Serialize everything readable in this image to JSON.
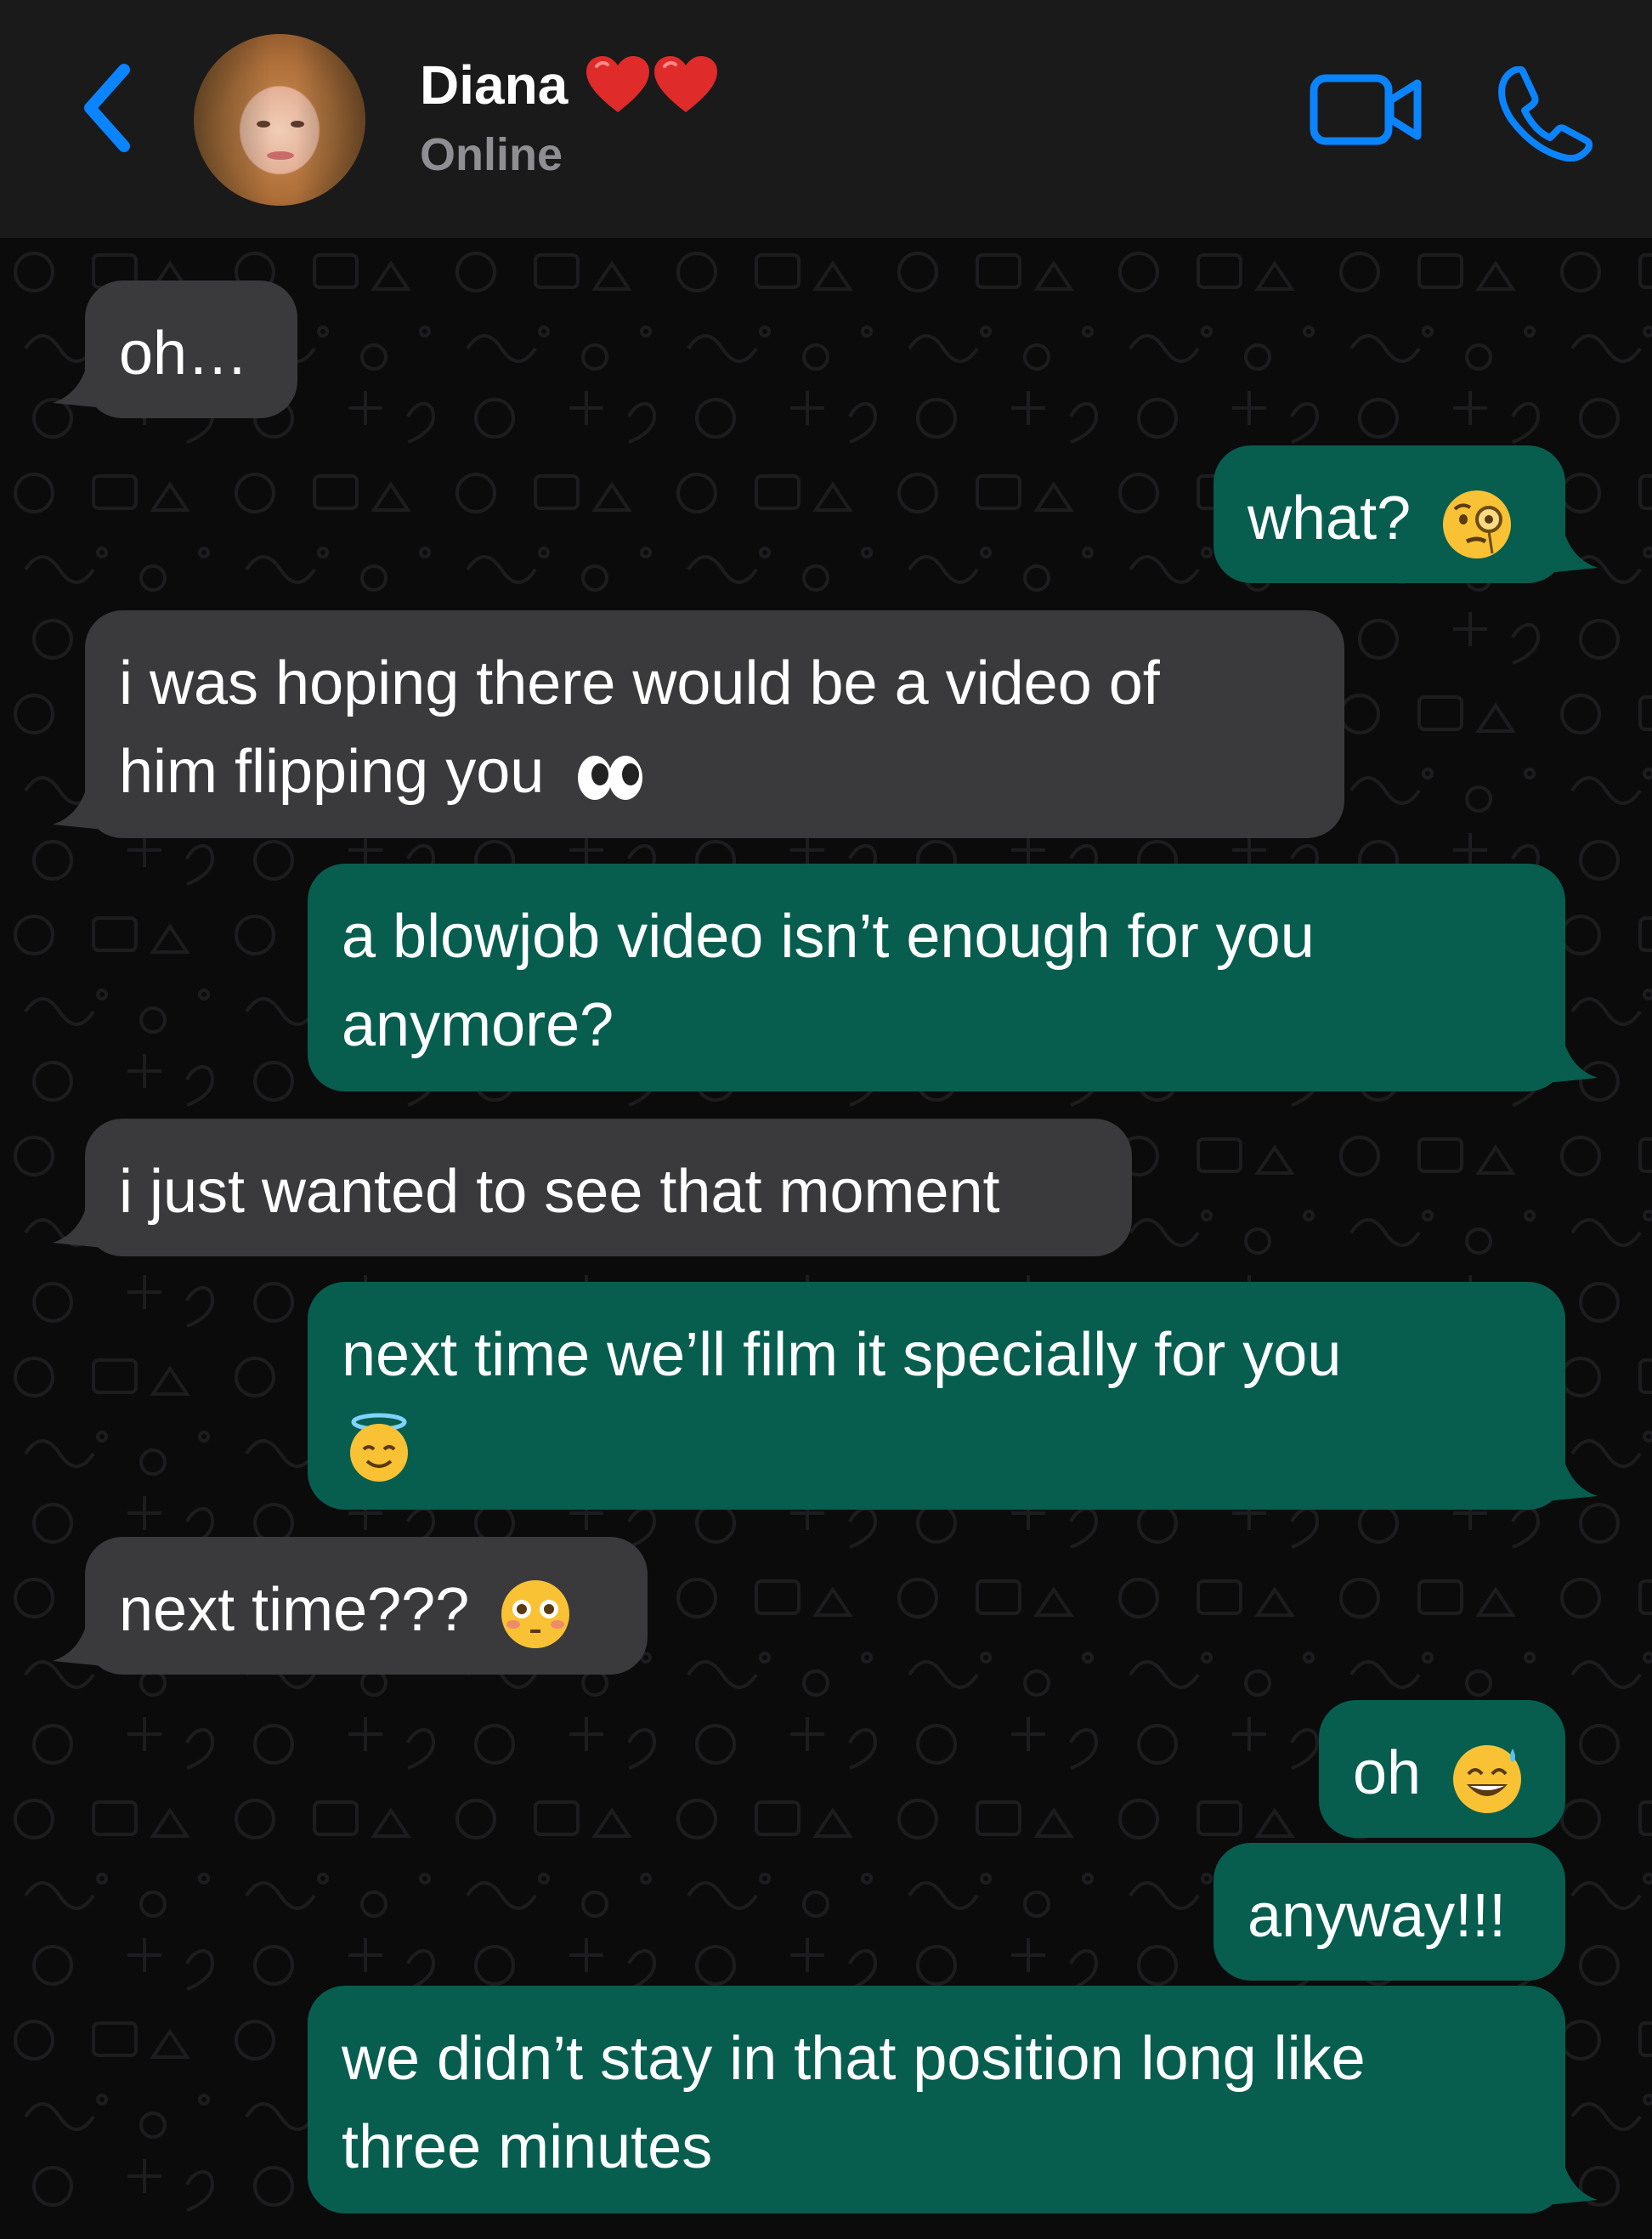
{
  "header": {
    "contact_name": "Diana",
    "status": "Online",
    "hearts_icon": "red-heart-emoji",
    "accent_color": "#0a84ff"
  },
  "messages": [
    {
      "direction": "in",
      "text": "oh…"
    },
    {
      "direction": "out",
      "text": "what?",
      "emoji": "face-with-monocle"
    },
    {
      "direction": "in",
      "text": "i was hoping there would be a video of\nhim flipping you",
      "emoji": "eyes"
    },
    {
      "direction": "out",
      "text": "a blowjob video isn’t enough for you\nanymore?"
    },
    {
      "direction": "in",
      "text": "i just wanted to see that moment"
    },
    {
      "direction": "out",
      "text": "next time we’ll film it specially for you",
      "emoji": "smiling-face-with-halo"
    },
    {
      "direction": "in",
      "text": "next time???",
      "emoji": "flushed-face"
    },
    {
      "direction": "out",
      "text": "oh",
      "emoji": "grinning-face-with-sweat"
    },
    {
      "direction": "out",
      "text": "anyway!!!"
    },
    {
      "direction": "out",
      "text": "we didn’t stay in that position long like\nthree minutes"
    }
  ],
  "colors": {
    "incoming_bubble": "#3a3a3c",
    "outgoing_bubble": "#075e4f",
    "header_bg": "#1a1a1a",
    "chat_bg": "#0b0b0c"
  }
}
